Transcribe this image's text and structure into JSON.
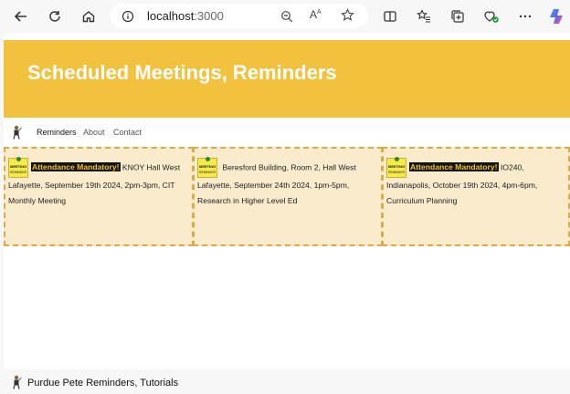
{
  "browser": {
    "url_host": "localhost",
    "url_port": ":3000",
    "icons": [
      "back-icon",
      "refresh-icon",
      "home-icon",
      "info-icon",
      "zoom-icon",
      "read-aloud-icon",
      "favorite-icon",
      "split-screen-icon",
      "favorites-icon",
      "collections-icon",
      "extensions-icon",
      "more-icon",
      "copilot-icon"
    ]
  },
  "header": {
    "title": "Scheduled Meetings, Reminders"
  },
  "nav": {
    "items": [
      "Reminders",
      "About",
      "Contact"
    ]
  },
  "cards": [
    {
      "badge": "Attendance Mandatory!",
      "text": " KNOY Hall West Lafayette, September 19th 2024, 2pm-3pm, CIT Monthly Meeting"
    },
    {
      "badge": "",
      "text": " Beresford Building, Room 2, Hall West Lafayette, September 24th 2024, 1pm-5pm, Research in Higher Level Ed"
    },
    {
      "badge": "Attendance Mandatory!",
      "text": " IO240, Indianapolis, October 19th 2024, 4pm-6pm, Curriculum Planning"
    }
  ],
  "meeting_image": {
    "line1": "MEETING",
    "line2": "REMINDER"
  },
  "footer": {
    "text": "Purdue Pete Reminders, Tutorials"
  },
  "colors": {
    "header_bg": "#f2c13d",
    "card_bg": "#faebcd",
    "card_border": "#d9ad44",
    "badge_bg": "#111111",
    "badge_fg": "#f5c518"
  }
}
